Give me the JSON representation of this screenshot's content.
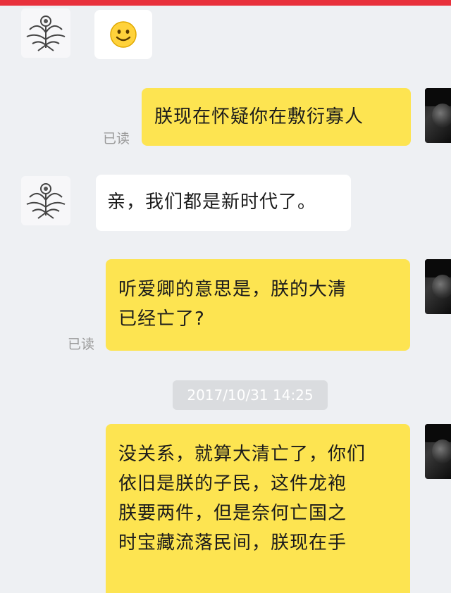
{
  "chat": {
    "messages": [
      {
        "id": "m1",
        "side": "left",
        "type": "emoji",
        "icon": "smiley-emoji"
      },
      {
        "id": "m2",
        "side": "right",
        "lines": [
          "朕现在怀疑你在敷衍寡人"
        ],
        "read_label": "已读"
      },
      {
        "id": "m3",
        "side": "left",
        "lines": [
          "亲，我们都是新时代了。"
        ]
      },
      {
        "id": "m4",
        "side": "right",
        "lines": [
          "听爱卿的意思是，朕的大清",
          "已经亡了?"
        ],
        "read_label": "已读"
      },
      {
        "id": "m5",
        "side": "right",
        "lines": [
          "没关系，就算大清亡了，你们",
          "依旧是朕的子民，这件龙袍",
          "朕要两件，但是奈何亡国之",
          "时宝藏流落民间，朕现在手"
        ]
      }
    ],
    "timestamp": "2017/10/31 14:25"
  },
  "colors": {
    "top_bar": "#e8313c",
    "background": "#eef0f3",
    "bubble_left": "#ffffff",
    "bubble_right": "#fde451",
    "read_text": "#9a9a9a"
  }
}
